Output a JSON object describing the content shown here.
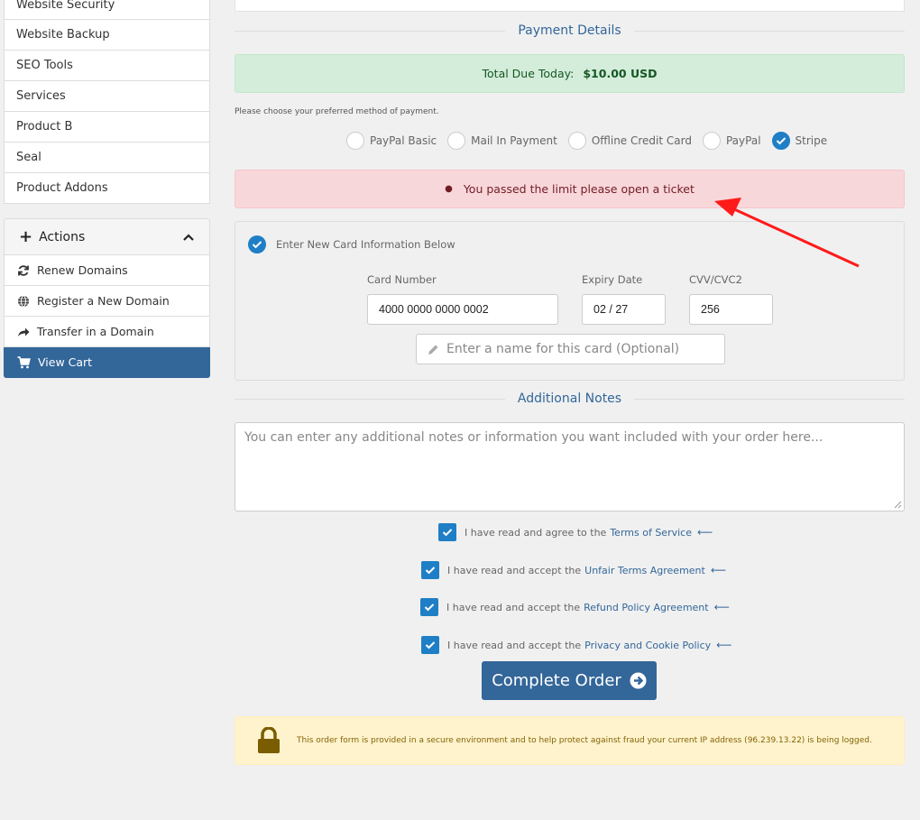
{
  "sidebar": {
    "items": [
      {
        "label": "Website Security"
      },
      {
        "label": "Website Backup"
      },
      {
        "label": "SEO Tools"
      },
      {
        "label": "Services"
      },
      {
        "label": "Product B"
      },
      {
        "label": "Seal"
      },
      {
        "label": "Product Addons"
      }
    ]
  },
  "actions": {
    "title": "Actions",
    "items": [
      {
        "label": "Renew Domains",
        "icon": "refresh-icon"
      },
      {
        "label": "Register a New Domain",
        "icon": "globe-icon"
      },
      {
        "label": "Transfer in a Domain",
        "icon": "share-arrow-icon"
      },
      {
        "label": "View Cart",
        "icon": "cart-icon"
      }
    ]
  },
  "payment": {
    "section_title": "Payment Details",
    "total_label": "Total Due Today:",
    "total_value": "$10.00 USD",
    "prompt": "Please choose your preferred method of payment.",
    "methods": [
      {
        "label": "PayPal Basic",
        "selected": false
      },
      {
        "label": "Mail In Payment",
        "selected": false
      },
      {
        "label": "Offline Credit Card",
        "selected": false
      },
      {
        "label": "PayPal",
        "selected": false
      },
      {
        "label": "Stripe",
        "selected": true
      }
    ],
    "error": "You passed the limit please open a ticket"
  },
  "card": {
    "new_card_label": "Enter New Card Information Below",
    "number_label": "Card Number",
    "number_value": "4000 0000 0000 0002",
    "expiry_label": "Expiry Date",
    "expiry_value": "02 / 27",
    "cvv_label": "CVV/CVC2",
    "cvv_value": "256",
    "name_placeholder": "Enter a name for this card (Optional)"
  },
  "notes": {
    "section_title": "Additional Notes",
    "placeholder": "You can enter any additional notes or information you want included with your order here..."
  },
  "agreements": [
    {
      "text": "I have read and agree to the",
      "link": "Terms of Service"
    },
    {
      "text": "I have read and accept the",
      "link": "Unfair Terms Agreement"
    },
    {
      "text": "I have read and accept the",
      "link": "Refund Policy Agreement"
    },
    {
      "text": "I have read and accept the",
      "link": "Privacy and Cookie Policy"
    }
  ],
  "complete_button": "Complete Order",
  "secure_notice": "This order form is provided in a secure environment and to help protect against fraud your current IP address (96.239.13.22) is being logged.",
  "colors": {
    "primary": "#336699",
    "check_blue": "#1e7fc6",
    "success_bg": "#d4edda",
    "error_bg": "#f8d7da",
    "warning_bg": "#fff3cd",
    "annotation_red": "#ff1a1a"
  }
}
